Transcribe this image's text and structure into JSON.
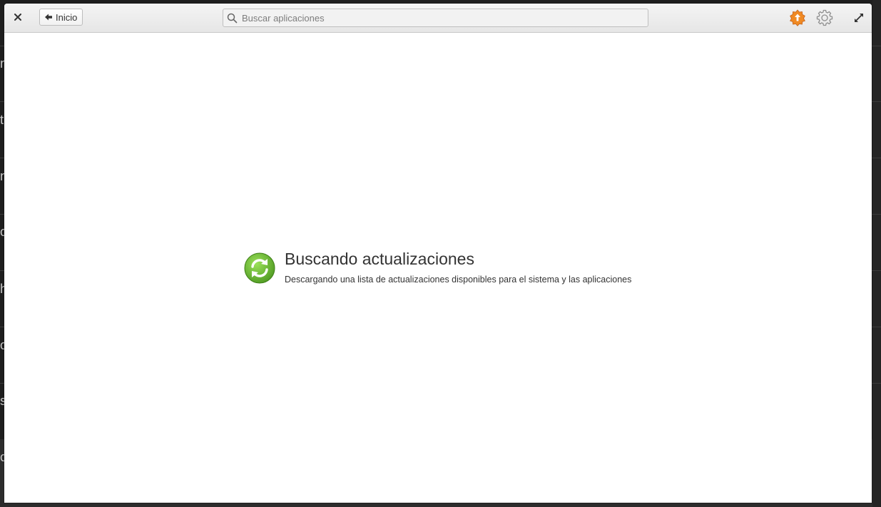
{
  "header": {
    "back_label": "Inicio",
    "search_placeholder": "Buscar aplicaciones"
  },
  "status": {
    "title": "Buscando actualizaciones",
    "subtitle": "Descargando una lista de actualizaciones disponibles para el sistema y las aplicaciones"
  },
  "background": {
    "letters": [
      "n",
      "t",
      "n",
      "o",
      "h",
      "o",
      "s",
      "c"
    ]
  },
  "colors": {
    "accent_green": "#6cbf3a",
    "updates_orange": "#f08a24"
  }
}
